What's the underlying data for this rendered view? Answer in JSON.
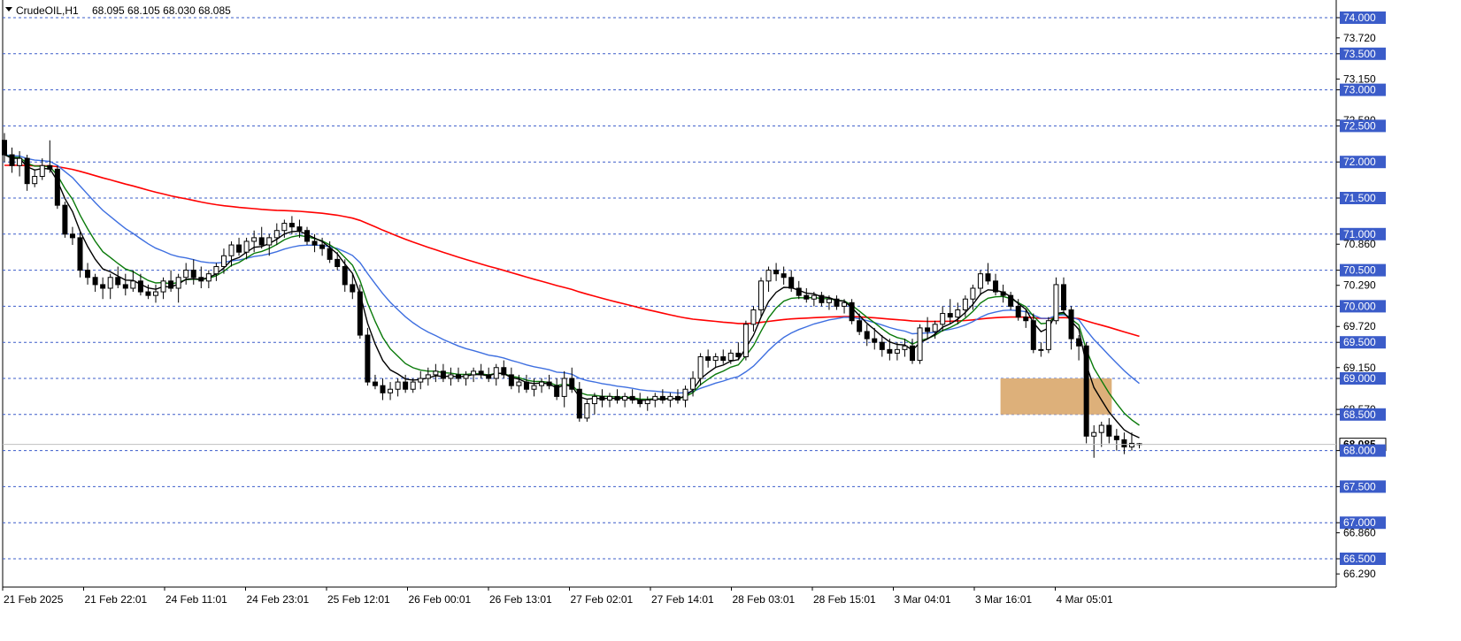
{
  "header": {
    "symbol": "CrudeOIL,H1",
    "ohlc": "68.095 68.105 68.030 68.085"
  },
  "colors": {
    "background": "#ffffff",
    "level_line": "#3b5cc9",
    "level_label_bg": "#3b5cc9",
    "ma_red": "#ff0000",
    "ma_blue": "#3e6fe0",
    "ma_green": "#0a7a0a",
    "ma_black": "#000000",
    "zone_fill": "#ddb07a",
    "candle": "#000000"
  },
  "chart_data": {
    "type": "candlestick",
    "symbol": "CrudeOIL",
    "timeframe": "H1",
    "ylim": [
      66.0,
      74.2
    ],
    "current_price": "68.085",
    "price_ticks": [
      "74.000",
      "73.720",
      "73.500",
      "73.150",
      "73.000",
      "72.580",
      "72.500",
      "72.000",
      "71.500",
      "71.000",
      "70.860",
      "70.500",
      "70.290",
      "70.000",
      "69.720",
      "69.500",
      "69.150",
      "69.000",
      "68.570",
      "68.500",
      "68.000",
      "67.500",
      "67.000",
      "66.860",
      "66.500",
      "66.290"
    ],
    "horizontal_levels": [
      "74.000",
      "73.500",
      "73.000",
      "72.500",
      "72.000",
      "71.500",
      "71.000",
      "70.500",
      "70.000",
      "69.500",
      "69.000",
      "68.500",
      "68.000",
      "67.500",
      "67.000",
      "66.500"
    ],
    "time_labels": [
      "21 Feb 2025",
      "21 Feb 22:01",
      "24 Feb 11:01",
      "24 Feb 23:01",
      "25 Feb 12:01",
      "26 Feb 00:01",
      "26 Feb 13:01",
      "27 Feb 02:01",
      "27 Feb 14:01",
      "28 Feb 03:01",
      "28 Feb 15:01",
      "3 Mar 04:01",
      "3 Mar 16:01",
      "4 Mar 05:01"
    ],
    "zone": {
      "from": 68.5,
      "to": 69.0,
      "start_bar": 132,
      "end_bar": 146
    },
    "bars": [
      {
        "o": 72.3,
        "h": 72.4,
        "l": 72.0,
        "c": 72.1
      },
      {
        "o": 72.1,
        "h": 72.2,
        "l": 71.85,
        "c": 71.95
      },
      {
        "o": 71.95,
        "h": 72.15,
        "l": 71.8,
        "c": 72.05
      },
      {
        "o": 72.05,
        "h": 72.1,
        "l": 71.6,
        "c": 71.7
      },
      {
        "o": 71.7,
        "h": 71.9,
        "l": 71.65,
        "c": 71.8
      },
      {
        "o": 71.8,
        "h": 72.05,
        "l": 71.75,
        "c": 71.95
      },
      {
        "o": 71.95,
        "h": 72.3,
        "l": 71.85,
        "c": 71.9
      },
      {
        "o": 71.9,
        "h": 71.95,
        "l": 71.35,
        "c": 71.4
      },
      {
        "o": 71.4,
        "h": 71.45,
        "l": 70.95,
        "c": 71.0
      },
      {
        "o": 71.0,
        "h": 71.1,
        "l": 70.85,
        "c": 70.95
      },
      {
        "o": 70.95,
        "h": 71.05,
        "l": 70.4,
        "c": 70.5
      },
      {
        "o": 70.5,
        "h": 70.6,
        "l": 70.3,
        "c": 70.4
      },
      {
        "o": 70.4,
        "h": 70.45,
        "l": 70.2,
        "c": 70.3
      },
      {
        "o": 70.3,
        "h": 70.4,
        "l": 70.1,
        "c": 70.25
      },
      {
        "o": 70.25,
        "h": 70.45,
        "l": 70.1,
        "c": 70.4
      },
      {
        "o": 70.4,
        "h": 70.55,
        "l": 70.25,
        "c": 70.3
      },
      {
        "o": 70.3,
        "h": 70.45,
        "l": 70.15,
        "c": 70.25
      },
      {
        "o": 70.25,
        "h": 70.5,
        "l": 70.2,
        "c": 70.35
      },
      {
        "o": 70.35,
        "h": 70.45,
        "l": 70.15,
        "c": 70.2
      },
      {
        "o": 70.2,
        "h": 70.3,
        "l": 70.1,
        "c": 70.15
      },
      {
        "o": 70.15,
        "h": 70.3,
        "l": 70.05,
        "c": 70.2
      },
      {
        "o": 70.2,
        "h": 70.4,
        "l": 70.1,
        "c": 70.35
      },
      {
        "o": 70.35,
        "h": 70.5,
        "l": 70.2,
        "c": 70.25
      },
      {
        "o": 70.25,
        "h": 70.45,
        "l": 70.05,
        "c": 70.4
      },
      {
        "o": 70.4,
        "h": 70.6,
        "l": 70.3,
        "c": 70.5
      },
      {
        "o": 70.5,
        "h": 70.65,
        "l": 70.3,
        "c": 70.4
      },
      {
        "o": 70.4,
        "h": 70.55,
        "l": 70.25,
        "c": 70.35
      },
      {
        "o": 70.35,
        "h": 70.5,
        "l": 70.25,
        "c": 70.45
      },
      {
        "o": 70.45,
        "h": 70.6,
        "l": 70.35,
        "c": 70.55
      },
      {
        "o": 70.55,
        "h": 70.8,
        "l": 70.45,
        "c": 70.7
      },
      {
        "o": 70.7,
        "h": 70.9,
        "l": 70.55,
        "c": 70.85
      },
      {
        "o": 70.85,
        "h": 70.95,
        "l": 70.7,
        "c": 70.75
      },
      {
        "o": 70.75,
        "h": 70.95,
        "l": 70.65,
        "c": 70.9
      },
      {
        "o": 70.9,
        "h": 71.05,
        "l": 70.75,
        "c": 70.95
      },
      {
        "o": 70.95,
        "h": 71.1,
        "l": 70.8,
        "c": 70.85
      },
      {
        "o": 70.85,
        "h": 71.0,
        "l": 70.7,
        "c": 70.95
      },
      {
        "o": 70.95,
        "h": 71.15,
        "l": 70.85,
        "c": 71.05
      },
      {
        "o": 71.05,
        "h": 71.2,
        "l": 70.95,
        "c": 71.15
      },
      {
        "o": 71.15,
        "h": 71.25,
        "l": 71.0,
        "c": 71.1
      },
      {
        "o": 71.1,
        "h": 71.2,
        "l": 70.95,
        "c": 71.05
      },
      {
        "o": 71.05,
        "h": 71.1,
        "l": 70.85,
        "c": 70.9
      },
      {
        "o": 70.9,
        "h": 71.0,
        "l": 70.75,
        "c": 70.85
      },
      {
        "o": 70.85,
        "h": 70.95,
        "l": 70.7,
        "c": 70.8
      },
      {
        "o": 70.8,
        "h": 70.9,
        "l": 70.6,
        "c": 70.65
      },
      {
        "o": 70.65,
        "h": 70.75,
        "l": 70.5,
        "c": 70.55
      },
      {
        "o": 70.55,
        "h": 70.65,
        "l": 70.2,
        "c": 70.3
      },
      {
        "o": 70.3,
        "h": 70.45,
        "l": 70.1,
        "c": 70.2
      },
      {
        "o": 70.2,
        "h": 70.3,
        "l": 69.55,
        "c": 69.6
      },
      {
        "o": 69.6,
        "h": 69.7,
        "l": 68.9,
        "c": 68.95
      },
      {
        "o": 68.95,
        "h": 69.05,
        "l": 68.85,
        "c": 68.9
      },
      {
        "o": 68.9,
        "h": 69.0,
        "l": 68.7,
        "c": 68.8
      },
      {
        "o": 68.8,
        "h": 68.95,
        "l": 68.7,
        "c": 68.85
      },
      {
        "o": 68.85,
        "h": 69.0,
        "l": 68.75,
        "c": 68.95
      },
      {
        "o": 68.95,
        "h": 69.05,
        "l": 68.8,
        "c": 68.85
      },
      {
        "o": 68.85,
        "h": 69.0,
        "l": 68.8,
        "c": 68.95
      },
      {
        "o": 68.95,
        "h": 69.1,
        "l": 68.85,
        "c": 69.0
      },
      {
        "o": 69.0,
        "h": 69.15,
        "l": 68.9,
        "c": 69.05
      },
      {
        "o": 69.05,
        "h": 69.2,
        "l": 68.95,
        "c": 69.1
      },
      {
        "o": 69.1,
        "h": 69.2,
        "l": 68.95,
        "c": 69.0
      },
      {
        "o": 69.0,
        "h": 69.15,
        "l": 68.9,
        "c": 69.05
      },
      {
        "o": 69.05,
        "h": 69.15,
        "l": 68.95,
        "c": 69.0
      },
      {
        "o": 69.0,
        "h": 69.1,
        "l": 68.9,
        "c": 69.05
      },
      {
        "o": 69.05,
        "h": 69.15,
        "l": 68.95,
        "c": 69.1
      },
      {
        "o": 69.1,
        "h": 69.2,
        "l": 69.0,
        "c": 69.05
      },
      {
        "o": 69.05,
        "h": 69.15,
        "l": 68.95,
        "c": 69.0
      },
      {
        "o": 69.0,
        "h": 69.2,
        "l": 68.9,
        "c": 69.15
      },
      {
        "o": 69.15,
        "h": 69.25,
        "l": 69.0,
        "c": 69.05
      },
      {
        "o": 69.05,
        "h": 69.15,
        "l": 68.85,
        "c": 68.9
      },
      {
        "o": 68.9,
        "h": 69.05,
        "l": 68.8,
        "c": 68.95
      },
      {
        "o": 68.95,
        "h": 69.05,
        "l": 68.8,
        "c": 68.85
      },
      {
        "o": 68.85,
        "h": 69.0,
        "l": 68.75,
        "c": 68.9
      },
      {
        "o": 68.9,
        "h": 69.0,
        "l": 68.8,
        "c": 68.95
      },
      {
        "o": 68.95,
        "h": 69.05,
        "l": 68.85,
        "c": 68.9
      },
      {
        "o": 68.9,
        "h": 69.0,
        "l": 68.7,
        "c": 68.75
      },
      {
        "o": 68.75,
        "h": 69.1,
        "l": 68.6,
        "c": 69.0
      },
      {
        "o": 69.0,
        "h": 69.15,
        "l": 68.8,
        "c": 68.85
      },
      {
        "o": 68.85,
        "h": 68.95,
        "l": 68.4,
        "c": 68.45
      },
      {
        "o": 68.45,
        "h": 68.7,
        "l": 68.4,
        "c": 68.65
      },
      {
        "o": 68.65,
        "h": 68.8,
        "l": 68.5,
        "c": 68.75
      },
      {
        "o": 68.75,
        "h": 68.85,
        "l": 68.6,
        "c": 68.7
      },
      {
        "o": 68.7,
        "h": 68.8,
        "l": 68.6,
        "c": 68.75
      },
      {
        "o": 68.75,
        "h": 68.85,
        "l": 68.65,
        "c": 68.7
      },
      {
        "o": 68.7,
        "h": 68.8,
        "l": 68.6,
        "c": 68.75
      },
      {
        "o": 68.75,
        "h": 68.85,
        "l": 68.65,
        "c": 68.7
      },
      {
        "o": 68.7,
        "h": 68.8,
        "l": 68.6,
        "c": 68.65
      },
      {
        "o": 68.65,
        "h": 68.75,
        "l": 68.55,
        "c": 68.7
      },
      {
        "o": 68.7,
        "h": 68.8,
        "l": 68.6,
        "c": 68.75
      },
      {
        "o": 68.75,
        "h": 68.85,
        "l": 68.65,
        "c": 68.7
      },
      {
        "o": 68.7,
        "h": 68.8,
        "l": 68.6,
        "c": 68.75
      },
      {
        "o": 68.75,
        "h": 68.85,
        "l": 68.65,
        "c": 68.7
      },
      {
        "o": 68.7,
        "h": 68.9,
        "l": 68.6,
        "c": 68.85
      },
      {
        "o": 68.85,
        "h": 69.1,
        "l": 68.75,
        "c": 69.0
      },
      {
        "o": 69.0,
        "h": 69.35,
        "l": 68.9,
        "c": 69.3
      },
      {
        "o": 69.3,
        "h": 69.4,
        "l": 69.15,
        "c": 69.25
      },
      {
        "o": 69.25,
        "h": 69.35,
        "l": 69.15,
        "c": 69.3
      },
      {
        "o": 69.3,
        "h": 69.4,
        "l": 69.2,
        "c": 69.25
      },
      {
        "o": 69.25,
        "h": 69.4,
        "l": 69.2,
        "c": 69.35
      },
      {
        "o": 69.35,
        "h": 69.5,
        "l": 69.25,
        "c": 69.3
      },
      {
        "o": 69.3,
        "h": 69.8,
        "l": 69.25,
        "c": 69.75
      },
      {
        "o": 69.75,
        "h": 70.0,
        "l": 69.65,
        "c": 69.95
      },
      {
        "o": 69.95,
        "h": 70.4,
        "l": 69.85,
        "c": 70.35
      },
      {
        "o": 70.35,
        "h": 70.55,
        "l": 70.2,
        "c": 70.5
      },
      {
        "o": 70.5,
        "h": 70.6,
        "l": 70.35,
        "c": 70.45
      },
      {
        "o": 70.45,
        "h": 70.55,
        "l": 70.3,
        "c": 70.4
      },
      {
        "o": 70.4,
        "h": 70.5,
        "l": 70.2,
        "c": 70.25
      },
      {
        "o": 70.25,
        "h": 70.35,
        "l": 70.1,
        "c": 70.15
      },
      {
        "o": 70.15,
        "h": 70.25,
        "l": 70.05,
        "c": 70.1
      },
      {
        "o": 70.1,
        "h": 70.2,
        "l": 70.0,
        "c": 70.15
      },
      {
        "o": 70.15,
        "h": 70.2,
        "l": 70.0,
        "c": 70.05
      },
      {
        "o": 70.05,
        "h": 70.15,
        "l": 69.95,
        "c": 70.1
      },
      {
        "o": 70.1,
        "h": 70.15,
        "l": 69.95,
        "c": 70.0
      },
      {
        "o": 70.0,
        "h": 70.1,
        "l": 69.9,
        "c": 70.05
      },
      {
        "o": 70.05,
        "h": 70.1,
        "l": 69.75,
        "c": 69.8
      },
      {
        "o": 69.8,
        "h": 69.9,
        "l": 69.6,
        "c": 69.65
      },
      {
        "o": 69.65,
        "h": 69.75,
        "l": 69.45,
        "c": 69.55
      },
      {
        "o": 69.55,
        "h": 69.7,
        "l": 69.4,
        "c": 69.5
      },
      {
        "o": 69.5,
        "h": 69.6,
        "l": 69.3,
        "c": 69.4
      },
      {
        "o": 69.4,
        "h": 69.55,
        "l": 69.25,
        "c": 69.35
      },
      {
        "o": 69.35,
        "h": 69.5,
        "l": 69.25,
        "c": 69.4
      },
      {
        "o": 69.4,
        "h": 69.55,
        "l": 69.3,
        "c": 69.45
      },
      {
        "o": 69.45,
        "h": 69.55,
        "l": 69.2,
        "c": 69.25
      },
      {
        "o": 69.25,
        "h": 69.75,
        "l": 69.2,
        "c": 69.7
      },
      {
        "o": 69.7,
        "h": 69.85,
        "l": 69.55,
        "c": 69.65
      },
      {
        "o": 69.65,
        "h": 69.8,
        "l": 69.55,
        "c": 69.75
      },
      {
        "o": 69.75,
        "h": 70.0,
        "l": 69.65,
        "c": 69.9
      },
      {
        "o": 69.9,
        "h": 70.1,
        "l": 69.75,
        "c": 69.85
      },
      {
        "o": 69.85,
        "h": 70.05,
        "l": 69.75,
        "c": 69.95
      },
      {
        "o": 69.95,
        "h": 70.15,
        "l": 69.85,
        "c": 70.1
      },
      {
        "o": 70.1,
        "h": 70.3,
        "l": 69.95,
        "c": 70.25
      },
      {
        "o": 70.25,
        "h": 70.5,
        "l": 70.15,
        "c": 70.45
      },
      {
        "o": 70.45,
        "h": 70.6,
        "l": 70.3,
        "c": 70.35
      },
      {
        "o": 70.35,
        "h": 70.45,
        "l": 70.15,
        "c": 70.2
      },
      {
        "o": 70.2,
        "h": 70.3,
        "l": 70.05,
        "c": 70.15
      },
      {
        "o": 70.15,
        "h": 70.2,
        "l": 69.95,
        "c": 70.0
      },
      {
        "o": 70.0,
        "h": 70.1,
        "l": 69.8,
        "c": 69.85
      },
      {
        "o": 69.85,
        "h": 69.95,
        "l": 69.7,
        "c": 69.8
      },
      {
        "o": 69.8,
        "h": 69.9,
        "l": 69.35,
        "c": 69.4
      },
      {
        "o": 69.4,
        "h": 69.5,
        "l": 69.3,
        "c": 69.4
      },
      {
        "o": 69.4,
        "h": 69.85,
        "l": 69.35,
        "c": 69.8
      },
      {
        "o": 69.8,
        "h": 70.4,
        "l": 69.75,
        "c": 70.3
      },
      {
        "o": 70.3,
        "h": 70.4,
        "l": 69.9,
        "c": 69.95
      },
      {
        "o": 69.95,
        "h": 70.0,
        "l": 69.4,
        "c": 69.55
      },
      {
        "o": 69.55,
        "h": 69.6,
        "l": 69.25,
        "c": 69.45
      },
      {
        "o": 69.45,
        "h": 69.5,
        "l": 68.1,
        "c": 68.2
      },
      {
        "o": 68.2,
        "h": 68.35,
        "l": 67.9,
        "c": 68.25
      },
      {
        "o": 68.25,
        "h": 68.4,
        "l": 68.05,
        "c": 68.35
      },
      {
        "o": 68.35,
        "h": 68.45,
        "l": 68.1,
        "c": 68.2
      },
      {
        "o": 68.2,
        "h": 68.3,
        "l": 68.0,
        "c": 68.15
      },
      {
        "o": 68.15,
        "h": 68.25,
        "l": 67.95,
        "c": 68.05
      },
      {
        "o": 68.05,
        "h": 68.25,
        "l": 68.0,
        "c": 68.1
      },
      {
        "o": 68.095,
        "h": 68.105,
        "l": 68.03,
        "c": 68.085
      }
    ]
  }
}
